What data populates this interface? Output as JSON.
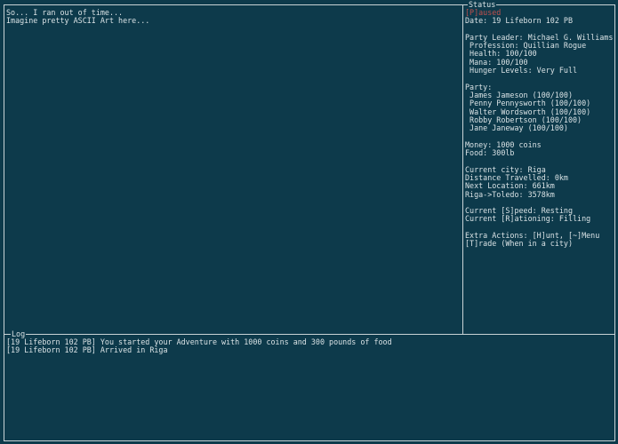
{
  "main": {
    "lines": [
      "So... I ran out of time...",
      "Imagine pretty ASCII Art here..."
    ]
  },
  "status": {
    "title": "Status",
    "paused": "[P]aused",
    "date": "Date: 19 Lifeborn 102 PB",
    "leader": "Party Leader: Michael G. Williams",
    "profession": " Profession: Quillian Rogue",
    "health": " Health: 100/100",
    "mana": " Mana: 100/100",
    "hunger": " Hunger Levels: Very Full",
    "party_header": "Party:",
    "party_members": [
      " James Jameson (100/100)",
      " Penny Pennysworth (100/100)",
      " Walter Wordsworth (100/100)",
      " Robby Robertson (100/100)",
      " Jane Janeway (100/100)"
    ],
    "money": "Money: 1000 coins",
    "food": "Food: 300lb",
    "current_city": "Current city: Riga",
    "distance": "Distance Travelled: 0km",
    "next_location": "Next Location: 661km",
    "route": "Riga->Toledo: 3578km",
    "speed": "Current [S]peed: Resting",
    "rationing": "Current [R]ationing: Filling",
    "extra_actions": "Extra Actions: [H]unt, [~]Menu",
    "trade": "[T]rade (When in a city)"
  },
  "log": {
    "title": "Log",
    "entries": [
      "[19 Lifeborn 102 PB] You started your Adventure with 1000 coins and 300 pounds of food",
      "[19 Lifeborn 102 PB] Arrived in Riga"
    ]
  }
}
